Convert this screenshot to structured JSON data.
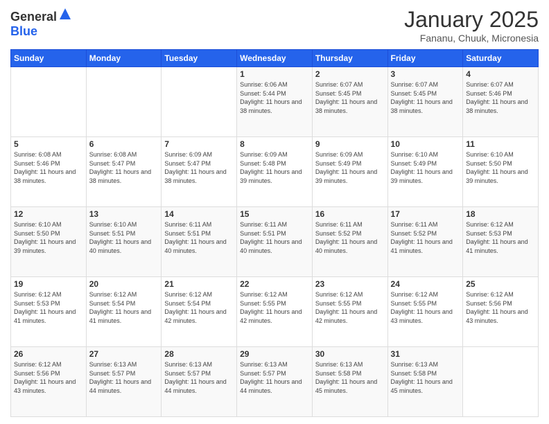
{
  "logo": {
    "general": "General",
    "blue": "Blue"
  },
  "title": {
    "month": "January 2025",
    "location": "Fananu, Chuuk, Micronesia"
  },
  "headers": [
    "Sunday",
    "Monday",
    "Tuesday",
    "Wednesday",
    "Thursday",
    "Friday",
    "Saturday"
  ],
  "weeks": [
    [
      {
        "day": "",
        "sunrise": "",
        "sunset": "",
        "daylight": ""
      },
      {
        "day": "",
        "sunrise": "",
        "sunset": "",
        "daylight": ""
      },
      {
        "day": "",
        "sunrise": "",
        "sunset": "",
        "daylight": ""
      },
      {
        "day": "1",
        "sunrise": "Sunrise: 6:06 AM",
        "sunset": "Sunset: 5:44 PM",
        "daylight": "Daylight: 11 hours and 38 minutes."
      },
      {
        "day": "2",
        "sunrise": "Sunrise: 6:07 AM",
        "sunset": "Sunset: 5:45 PM",
        "daylight": "Daylight: 11 hours and 38 minutes."
      },
      {
        "day": "3",
        "sunrise": "Sunrise: 6:07 AM",
        "sunset": "Sunset: 5:45 PM",
        "daylight": "Daylight: 11 hours and 38 minutes."
      },
      {
        "day": "4",
        "sunrise": "Sunrise: 6:07 AM",
        "sunset": "Sunset: 5:46 PM",
        "daylight": "Daylight: 11 hours and 38 minutes."
      }
    ],
    [
      {
        "day": "5",
        "sunrise": "Sunrise: 6:08 AM",
        "sunset": "Sunset: 5:46 PM",
        "daylight": "Daylight: 11 hours and 38 minutes."
      },
      {
        "day": "6",
        "sunrise": "Sunrise: 6:08 AM",
        "sunset": "Sunset: 5:47 PM",
        "daylight": "Daylight: 11 hours and 38 minutes."
      },
      {
        "day": "7",
        "sunrise": "Sunrise: 6:09 AM",
        "sunset": "Sunset: 5:47 PM",
        "daylight": "Daylight: 11 hours and 38 minutes."
      },
      {
        "day": "8",
        "sunrise": "Sunrise: 6:09 AM",
        "sunset": "Sunset: 5:48 PM",
        "daylight": "Daylight: 11 hours and 39 minutes."
      },
      {
        "day": "9",
        "sunrise": "Sunrise: 6:09 AM",
        "sunset": "Sunset: 5:49 PM",
        "daylight": "Daylight: 11 hours and 39 minutes."
      },
      {
        "day": "10",
        "sunrise": "Sunrise: 6:10 AM",
        "sunset": "Sunset: 5:49 PM",
        "daylight": "Daylight: 11 hours and 39 minutes."
      },
      {
        "day": "11",
        "sunrise": "Sunrise: 6:10 AM",
        "sunset": "Sunset: 5:50 PM",
        "daylight": "Daylight: 11 hours and 39 minutes."
      }
    ],
    [
      {
        "day": "12",
        "sunrise": "Sunrise: 6:10 AM",
        "sunset": "Sunset: 5:50 PM",
        "daylight": "Daylight: 11 hours and 39 minutes."
      },
      {
        "day": "13",
        "sunrise": "Sunrise: 6:10 AM",
        "sunset": "Sunset: 5:51 PM",
        "daylight": "Daylight: 11 hours and 40 minutes."
      },
      {
        "day": "14",
        "sunrise": "Sunrise: 6:11 AM",
        "sunset": "Sunset: 5:51 PM",
        "daylight": "Daylight: 11 hours and 40 minutes."
      },
      {
        "day": "15",
        "sunrise": "Sunrise: 6:11 AM",
        "sunset": "Sunset: 5:51 PM",
        "daylight": "Daylight: 11 hours and 40 minutes."
      },
      {
        "day": "16",
        "sunrise": "Sunrise: 6:11 AM",
        "sunset": "Sunset: 5:52 PM",
        "daylight": "Daylight: 11 hours and 40 minutes."
      },
      {
        "day": "17",
        "sunrise": "Sunrise: 6:11 AM",
        "sunset": "Sunset: 5:52 PM",
        "daylight": "Daylight: 11 hours and 41 minutes."
      },
      {
        "day": "18",
        "sunrise": "Sunrise: 6:12 AM",
        "sunset": "Sunset: 5:53 PM",
        "daylight": "Daylight: 11 hours and 41 minutes."
      }
    ],
    [
      {
        "day": "19",
        "sunrise": "Sunrise: 6:12 AM",
        "sunset": "Sunset: 5:53 PM",
        "daylight": "Daylight: 11 hours and 41 minutes."
      },
      {
        "day": "20",
        "sunrise": "Sunrise: 6:12 AM",
        "sunset": "Sunset: 5:54 PM",
        "daylight": "Daylight: 11 hours and 41 minutes."
      },
      {
        "day": "21",
        "sunrise": "Sunrise: 6:12 AM",
        "sunset": "Sunset: 5:54 PM",
        "daylight": "Daylight: 11 hours and 42 minutes."
      },
      {
        "day": "22",
        "sunrise": "Sunrise: 6:12 AM",
        "sunset": "Sunset: 5:55 PM",
        "daylight": "Daylight: 11 hours and 42 minutes."
      },
      {
        "day": "23",
        "sunrise": "Sunrise: 6:12 AM",
        "sunset": "Sunset: 5:55 PM",
        "daylight": "Daylight: 11 hours and 42 minutes."
      },
      {
        "day": "24",
        "sunrise": "Sunrise: 6:12 AM",
        "sunset": "Sunset: 5:55 PM",
        "daylight": "Daylight: 11 hours and 43 minutes."
      },
      {
        "day": "25",
        "sunrise": "Sunrise: 6:12 AM",
        "sunset": "Sunset: 5:56 PM",
        "daylight": "Daylight: 11 hours and 43 minutes."
      }
    ],
    [
      {
        "day": "26",
        "sunrise": "Sunrise: 6:12 AM",
        "sunset": "Sunset: 5:56 PM",
        "daylight": "Daylight: 11 hours and 43 minutes."
      },
      {
        "day": "27",
        "sunrise": "Sunrise: 6:13 AM",
        "sunset": "Sunset: 5:57 PM",
        "daylight": "Daylight: 11 hours and 44 minutes."
      },
      {
        "day": "28",
        "sunrise": "Sunrise: 6:13 AM",
        "sunset": "Sunset: 5:57 PM",
        "daylight": "Daylight: 11 hours and 44 minutes."
      },
      {
        "day": "29",
        "sunrise": "Sunrise: 6:13 AM",
        "sunset": "Sunset: 5:57 PM",
        "daylight": "Daylight: 11 hours and 44 minutes."
      },
      {
        "day": "30",
        "sunrise": "Sunrise: 6:13 AM",
        "sunset": "Sunset: 5:58 PM",
        "daylight": "Daylight: 11 hours and 45 minutes."
      },
      {
        "day": "31",
        "sunrise": "Sunrise: 6:13 AM",
        "sunset": "Sunset: 5:58 PM",
        "daylight": "Daylight: 11 hours and 45 minutes."
      },
      {
        "day": "",
        "sunrise": "",
        "sunset": "",
        "daylight": ""
      }
    ]
  ]
}
